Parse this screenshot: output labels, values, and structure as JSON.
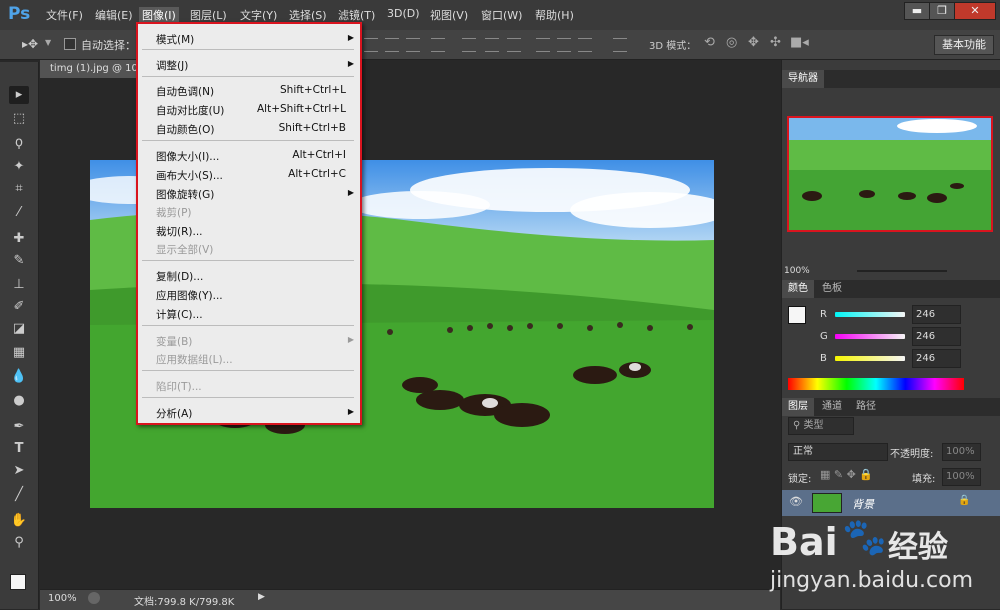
{
  "app": {
    "logo": "Ps"
  },
  "menubar": {
    "items": [
      "文件(F)",
      "编辑(E)",
      "图像(I)",
      "图层(L)",
      "文字(Y)",
      "选择(S)",
      "滤镜(T)",
      "3D(D)",
      "视图(V)",
      "窗口(W)",
      "帮助(H)"
    ],
    "active": "图像(I)"
  },
  "window_controls": {
    "minimize": "▬",
    "maximize": "❐",
    "close": "✕"
  },
  "options_bar": {
    "auto_select_label": "自动选择：",
    "mode3d_label": "3D 模式：",
    "workspace": "基本功能"
  },
  "document": {
    "tab_title": "timg (1).jpg @ 10"
  },
  "status_bar": {
    "zoom": "100%",
    "doc_info": "文档:799.8 K/799.8K"
  },
  "dropdown": {
    "items": [
      {
        "label": "模式(M)",
        "shortcut": "",
        "submenu": true,
        "disabled": false
      },
      {
        "label": "调整(J)",
        "shortcut": "",
        "submenu": true,
        "disabled": false
      },
      {
        "label": "自动色调(N)",
        "shortcut": "Shift+Ctrl+L",
        "submenu": false,
        "disabled": false
      },
      {
        "label": "自动对比度(U)",
        "shortcut": "Alt+Shift+Ctrl+L",
        "submenu": false,
        "disabled": false
      },
      {
        "label": "自动颜色(O)",
        "shortcut": "Shift+Ctrl+B",
        "submenu": false,
        "disabled": false
      },
      {
        "label": "图像大小(I)...",
        "shortcut": "Alt+Ctrl+I",
        "submenu": false,
        "disabled": false
      },
      {
        "label": "画布大小(S)...",
        "shortcut": "Alt+Ctrl+C",
        "submenu": false,
        "disabled": false
      },
      {
        "label": "图像旋转(G)",
        "shortcut": "",
        "submenu": true,
        "disabled": false
      },
      {
        "label": "裁剪(P)",
        "shortcut": "",
        "submenu": false,
        "disabled": true
      },
      {
        "label": "裁切(R)...",
        "shortcut": "",
        "submenu": false,
        "disabled": false
      },
      {
        "label": "显示全部(V)",
        "shortcut": "",
        "submenu": false,
        "disabled": true
      },
      {
        "label": "复制(D)...",
        "shortcut": "",
        "submenu": false,
        "disabled": false
      },
      {
        "label": "应用图像(Y)...",
        "shortcut": "",
        "submenu": false,
        "disabled": false
      },
      {
        "label": "计算(C)...",
        "shortcut": "",
        "submenu": false,
        "disabled": false
      },
      {
        "label": "变量(B)",
        "shortcut": "",
        "submenu": true,
        "disabled": true
      },
      {
        "label": "应用数据组(L)...",
        "shortcut": "",
        "submenu": false,
        "disabled": true
      },
      {
        "label": "陷印(T)...",
        "shortcut": "",
        "submenu": false,
        "disabled": true
      },
      {
        "label": "分析(A)",
        "shortcut": "",
        "submenu": true,
        "disabled": false
      }
    ]
  },
  "navigator": {
    "tab": "导航器",
    "zoom": "100%"
  },
  "color_panel": {
    "tabs": [
      "颜色",
      "色板"
    ],
    "channels": [
      {
        "label": "R",
        "value": "246"
      },
      {
        "label": "G",
        "value": "246"
      },
      {
        "label": "B",
        "value": "246"
      }
    ]
  },
  "layers_panel": {
    "tabs": [
      "图层",
      "通道",
      "路径"
    ],
    "filter": "类型",
    "blend_mode": "正常",
    "opacity_label": "不透明度:",
    "opacity": "100%",
    "lock_label": "锁定:",
    "fill_label": "填充:",
    "fill": "100%",
    "layer_name": "背景"
  },
  "watermark": {
    "brand": "Bai",
    "brand_suffix": "经验",
    "url": "jingyan.baidu.com"
  },
  "colors": {
    "highlight_border": "#d9141f",
    "menu_bg": "#ececec"
  }
}
